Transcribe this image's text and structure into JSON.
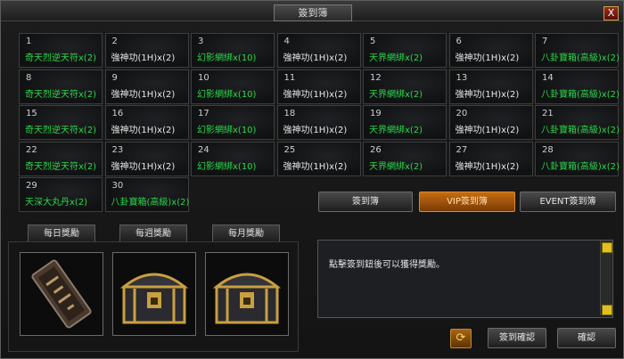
{
  "window": {
    "title": "簽到簿",
    "close_label": "X"
  },
  "days": [
    {
      "num": "1",
      "name": "奇天烈逆天符x(2)",
      "color": "green"
    },
    {
      "num": "2",
      "name": "強神功(1H)x(2)",
      "color": "white"
    },
    {
      "num": "3",
      "name": "幻影網綁x(10)",
      "color": "green"
    },
    {
      "num": "4",
      "name": "強神功(1H)x(2)",
      "color": "white"
    },
    {
      "num": "5",
      "name": "天界網綁x(2)",
      "color": "green"
    },
    {
      "num": "6",
      "name": "強神功(1H)x(2)",
      "color": "white"
    },
    {
      "num": "7",
      "name": "八卦寶箱(高級)x(2)",
      "color": "green"
    },
    {
      "num": "8",
      "name": "奇天烈逆天符x(2)",
      "color": "green"
    },
    {
      "num": "9",
      "name": "強神功(1H)x(2)",
      "color": "white"
    },
    {
      "num": "10",
      "name": "幻影網綁x(10)",
      "color": "green"
    },
    {
      "num": "11",
      "name": "強神功(1H)x(2)",
      "color": "white"
    },
    {
      "num": "12",
      "name": "天界網綁x(2)",
      "color": "green"
    },
    {
      "num": "13",
      "name": "強神功(1H)x(2)",
      "color": "white"
    },
    {
      "num": "14",
      "name": "八卦寶箱(高級)x(2)",
      "color": "green"
    },
    {
      "num": "15",
      "name": "奇天烈逆天符x(2)",
      "color": "green"
    },
    {
      "num": "16",
      "name": "強神功(1H)x(2)",
      "color": "white"
    },
    {
      "num": "17",
      "name": "幻影網綁x(10)",
      "color": "green"
    },
    {
      "num": "18",
      "name": "強神功(1H)x(2)",
      "color": "white"
    },
    {
      "num": "19",
      "name": "天界網綁x(2)",
      "color": "green"
    },
    {
      "num": "20",
      "name": "強神功(1H)x(2)",
      "color": "white"
    },
    {
      "num": "21",
      "name": "八卦寶箱(高級)x(2)",
      "color": "green"
    },
    {
      "num": "22",
      "name": "奇天烈逆天符x(2)",
      "color": "green"
    },
    {
      "num": "23",
      "name": "強神功(1H)x(2)",
      "color": "white"
    },
    {
      "num": "24",
      "name": "幻影網綁x(10)",
      "color": "green"
    },
    {
      "num": "25",
      "name": "強神功(1H)x(2)",
      "color": "white"
    },
    {
      "num": "26",
      "name": "天界網綁x(2)",
      "color": "green"
    },
    {
      "num": "27",
      "name": "強神功(1H)x(2)",
      "color": "white"
    },
    {
      "num": "28",
      "name": "八卦寶箱(高級)x(2)",
      "color": "green"
    },
    {
      "num": "29",
      "name": "天深大丸丹x(2)",
      "color": "green"
    },
    {
      "num": "30",
      "name": "八卦寶箱(高級)x(2)",
      "color": "green"
    }
  ],
  "mode_buttons": {
    "checkin": "簽到簿",
    "vip": "VIP簽到簿",
    "event": "EVENT簽到簿"
  },
  "reward_tabs": {
    "daily": "每日獎勵",
    "weekly": "每週獎勵",
    "monthly": "每月獎勵"
  },
  "message": "點擊簽到鈕後可以獲得獎勵。",
  "actions": {
    "confirm_checkin": "簽到確認",
    "confirm": "確認"
  },
  "colors": {
    "green_text": "#2ad84a",
    "white_text": "#e8e8e8",
    "vip_accent": "#c46d12"
  }
}
